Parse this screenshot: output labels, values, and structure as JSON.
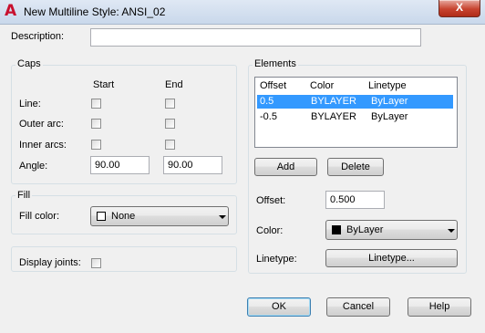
{
  "window": {
    "title": "New Multiline Style: ANSI_02",
    "close_glyph": "X"
  },
  "description": {
    "label": "Description:",
    "value": ""
  },
  "caps": {
    "title": "Caps",
    "start_header": "Start",
    "end_header": "End",
    "line_label": "Line:",
    "outer_arc_label": "Outer arc:",
    "inner_arcs_label": "Inner arcs:",
    "angle_label": "Angle:",
    "angle_start": "90.00",
    "angle_end": "90.00"
  },
  "fill": {
    "title": "Fill",
    "color_label": "Fill color:",
    "color_value": "None"
  },
  "display_joints": {
    "label": "Display joints:"
  },
  "elements": {
    "title": "Elements",
    "columns": [
      "Offset",
      "Color",
      "Linetype"
    ],
    "rows": [
      {
        "offset": "0.5",
        "color": "BYLAYER",
        "linetype": "ByLayer",
        "selected": true
      },
      {
        "offset": "-0.5",
        "color": "BYLAYER",
        "linetype": "ByLayer",
        "selected": false
      }
    ],
    "add_label": "Add",
    "delete_label": "Delete",
    "offset_label": "Offset:",
    "offset_value": "0.500",
    "color_label": "Color:",
    "color_value": "ByLayer",
    "linetype_label": "Linetype:",
    "linetype_button": "Linetype..."
  },
  "buttons": {
    "ok": "OK",
    "cancel": "Cancel",
    "help": "Help"
  },
  "colors": {
    "selection": "#3399ff",
    "app_icon": "#c8102e",
    "close": "#c7432f"
  }
}
